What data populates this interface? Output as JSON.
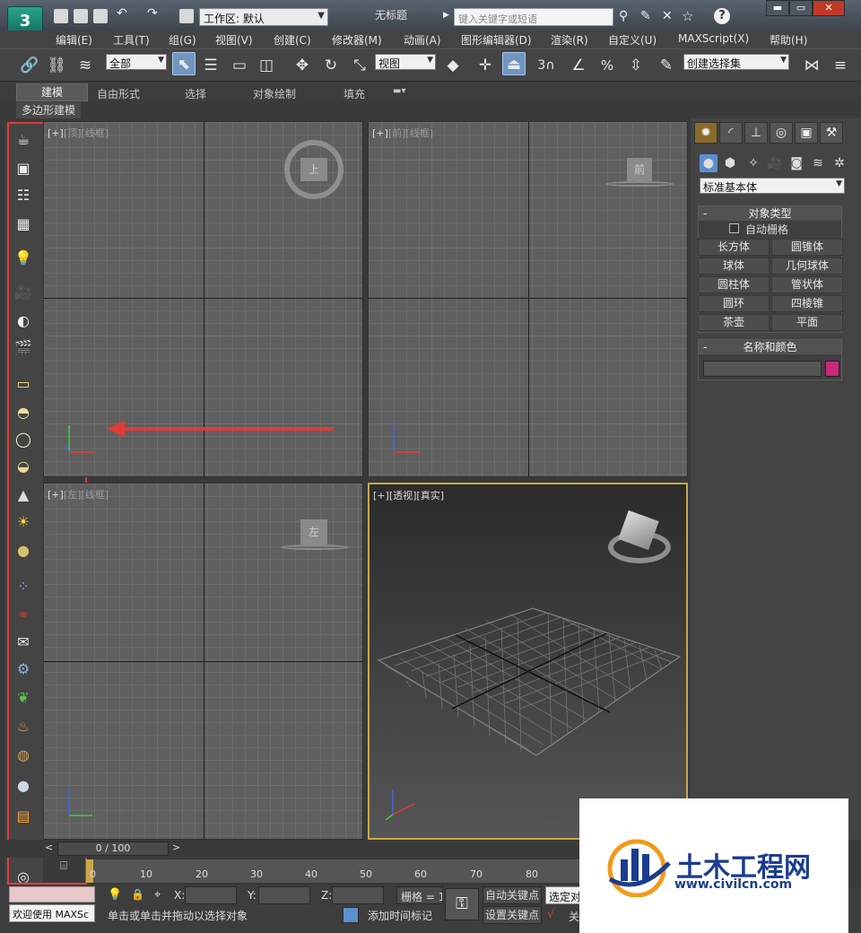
{
  "window": {
    "title": "无标题",
    "workspace": "工作区: 默认",
    "search_placeholder": "键入关键字或短语",
    "min": "▬",
    "max": "▭",
    "close": "✕"
  },
  "menu": [
    "编辑(E)",
    "工具(T)",
    "组(G)",
    "视图(V)",
    "创建(C)",
    "修改器(M)",
    "动画(A)",
    "图形编辑器(D)",
    "渲染(R)",
    "自定义(U)",
    "MAXScript(X)",
    "帮助(H)"
  ],
  "toolbar": {
    "filter": "全部",
    "ref_coord": "视图",
    "selection_set": "创建选择集",
    "snap_label": "3"
  },
  "ribbon": {
    "tabs": [
      "建模",
      "自由形式",
      "选择",
      "对象绘制",
      "填充"
    ],
    "subtab": "多边形建模"
  },
  "viewports": {
    "top": {
      "label": "[+]",
      "view": "[顶]",
      "shading": "[线框]",
      "cube": "上"
    },
    "front": {
      "label": "[+]",
      "view": "[前]",
      "shading": "[线框]",
      "cube": "前"
    },
    "left": {
      "label": "[+]",
      "view": "[左]",
      "shading": "[线框]",
      "cube": "左"
    },
    "persp": {
      "label": "[+]",
      "view": "[透视]",
      "shading": "[真实]"
    }
  },
  "command_panel": {
    "category": "标准基本体",
    "object_type": {
      "title": "对象类型",
      "autogrid": "自动栅格",
      "buttons": [
        "长方体",
        "圆锥体",
        "球体",
        "几何球体",
        "圆柱体",
        "管状体",
        "圆环",
        "四棱锥",
        "茶壶",
        "平面"
      ]
    },
    "name_color": {
      "title": "名称和颜色",
      "name": "",
      "color": "#c8287a"
    }
  },
  "timeline": {
    "frame": "0 / 100",
    "ticks": [
      "0",
      "10",
      "20",
      "30",
      "40",
      "50",
      "60",
      "70",
      "80"
    ]
  },
  "status": {
    "welcome": "欢迎使用 MAXSc",
    "hint": "单击或单击并拖动以选择对象",
    "add_tag": "添加时间标记",
    "x_label": "X:",
    "y_label": "Y:",
    "z_label": "Z:",
    "grid": "栅格 = 1",
    "auto_key": "自动关键点",
    "set_key": "设置关键点",
    "selected": "选定对",
    "key_filter": "关"
  },
  "watermark": {
    "title": "土木工程网",
    "url": "www.civilcn.com"
  },
  "colors": {
    "highlight": "#e53935",
    "accent": "#6f95c0",
    "persp_border": "#c6a84a"
  }
}
